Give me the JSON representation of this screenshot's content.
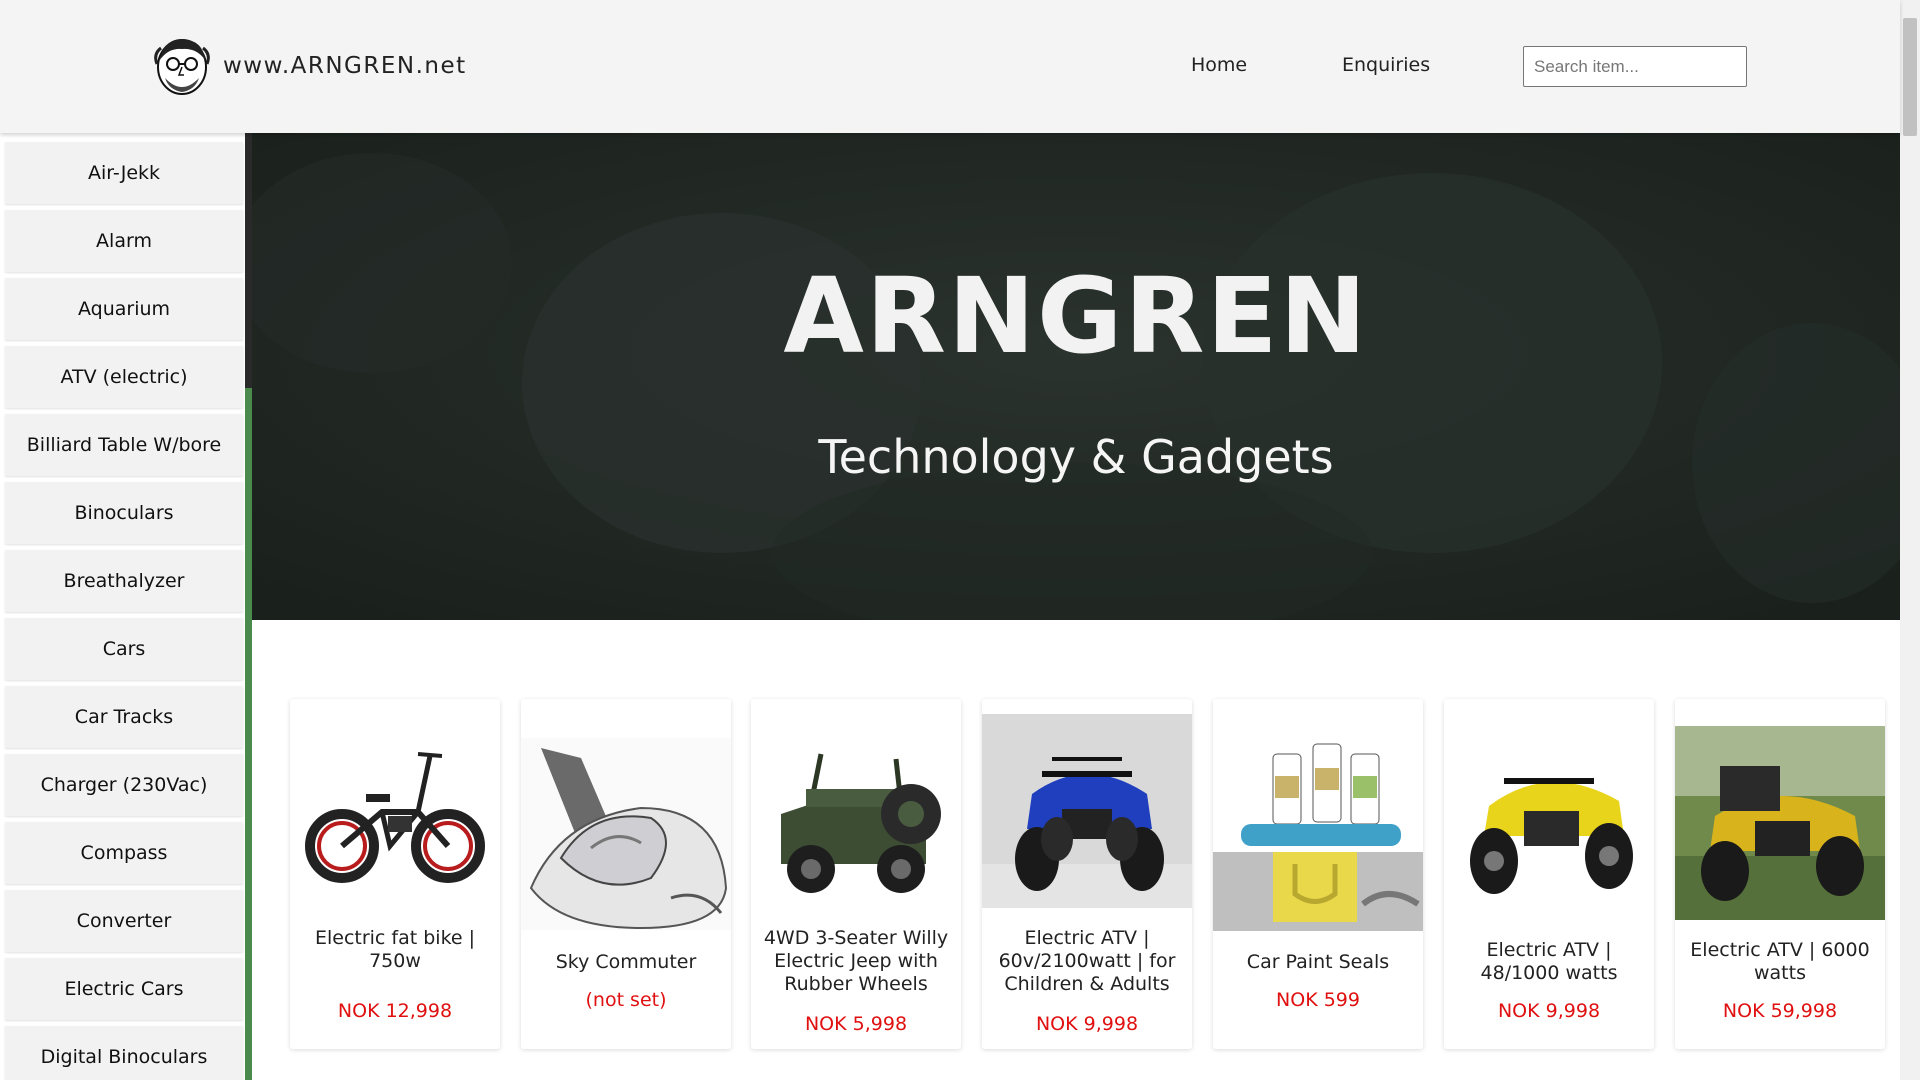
{
  "header": {
    "site_name": "www.ARNGREN.net",
    "nav": {
      "home": "Home",
      "enquiries": "Enquiries"
    },
    "search": {
      "placeholder": "Search item...",
      "value": ""
    }
  },
  "sidebar": {
    "items": [
      "Air-Jekk",
      "Alarm",
      "Aquarium",
      "ATV (electric)",
      "Billiard Table W/bore",
      "Binoculars",
      "Breathalyzer",
      "Cars",
      "Car Tracks",
      "Charger (230Vac)",
      "Compass",
      "Converter",
      "Electric Cars",
      "Digital Binoculars"
    ],
    "accent_color": "#4a8a4d"
  },
  "hero": {
    "title": "ARNGREN",
    "subtitle": "Technology & Gadgets"
  },
  "products": [
    {
      "name": "Electric fat bike | 750w",
      "price": "NOK 12,998",
      "image": "fat-bike"
    },
    {
      "name": "Sky Commuter",
      "price": "(not set)",
      "image": "sky-commuter"
    },
    {
      "name": "4WD 3-Seater Willy Electric Jeep with Rubber Wheels",
      "price": "NOK 5,998",
      "image": "jeep"
    },
    {
      "name": "Electric ATV | 60v/2100watt | for Children & Adults",
      "price": "NOK 9,998",
      "image": "blue-atv"
    },
    {
      "name": "Car Paint Seals",
      "price": "NOK 599",
      "image": "paint-seals"
    },
    {
      "name": "Electric ATV | 48/1000 watts",
      "price": "NOK 9,998",
      "image": "yellow-atv"
    },
    {
      "name": "Electric ATV | 6000 watts",
      "price": "NOK 59,998",
      "image": "yellow-atv-grass"
    }
  ],
  "colors": {
    "price": "#e01010",
    "hero_bg": "#1f2622",
    "header_bg": "#f4f4f4"
  }
}
